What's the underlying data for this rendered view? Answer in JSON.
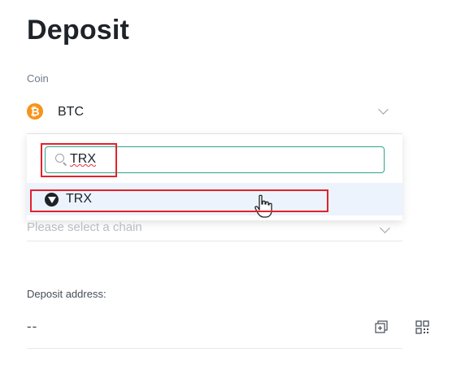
{
  "page": {
    "title": "Deposit"
  },
  "coin": {
    "label": "Coin",
    "selected": "BTC",
    "icon": "bitcoin-icon",
    "icon_color": "#f7931a"
  },
  "dropdown": {
    "search_value": "TRX",
    "search_icon": "search-icon",
    "options": [
      {
        "label": "TRX",
        "icon": "tron-icon"
      }
    ],
    "highlight_color": "#edf3fc",
    "border_accent": "#2ea58f"
  },
  "network": {
    "placeholder": "Please select a chain"
  },
  "address": {
    "label": "Deposit address:",
    "value": "--",
    "copy_icon": "copy-icon",
    "qr_icon": "qr-code-icon"
  },
  "annotation_color": "#e3222c"
}
